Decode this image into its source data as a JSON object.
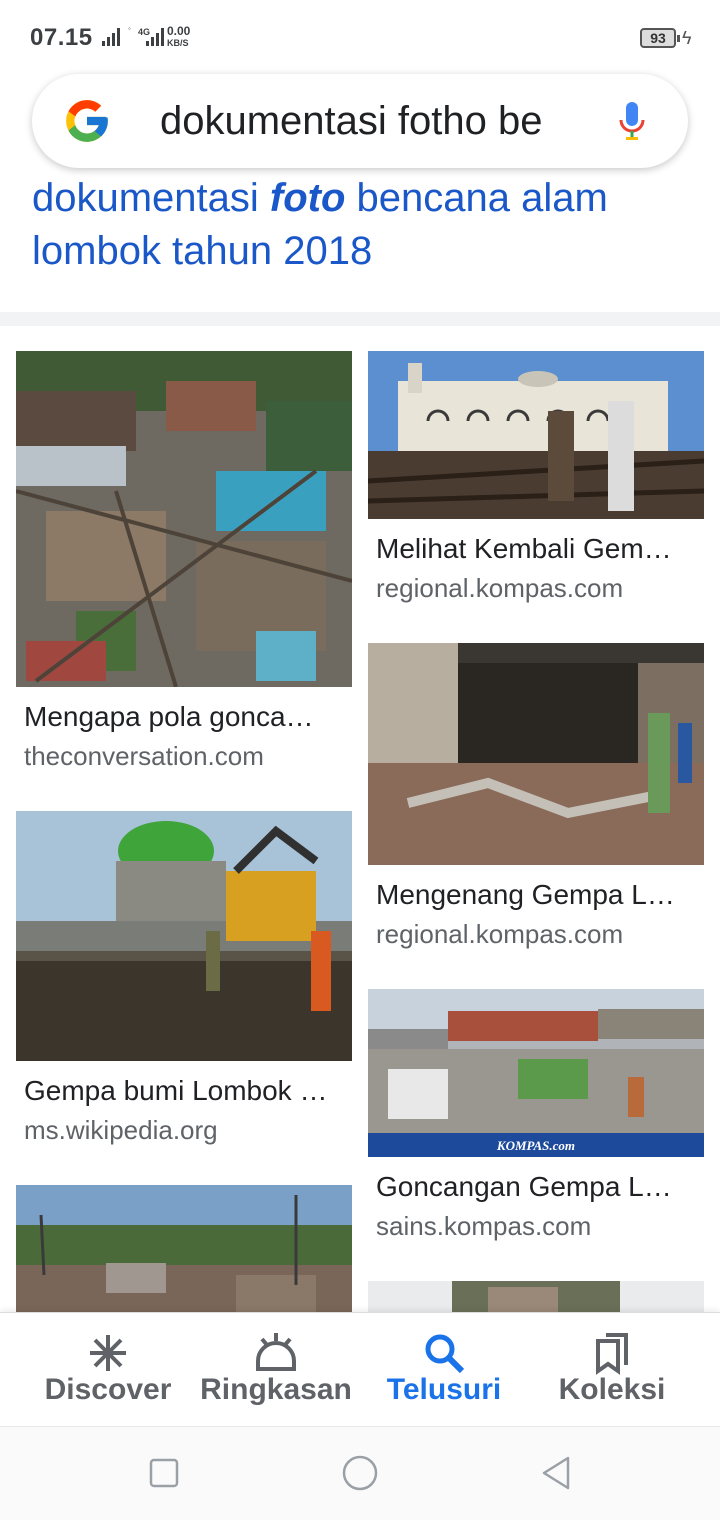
{
  "status_bar": {
    "time": "07.15",
    "network": "4G",
    "speed_value": "0.00",
    "speed_unit": "KB/S",
    "battery": "93"
  },
  "search": {
    "query": "dokumentasi fotho be",
    "google_logo_icon": "google-g-logo",
    "mic_icon": "microphone-icon"
  },
  "result": {
    "title_part1": "dokumentasi ",
    "title_bold": "foto",
    "title_part2": " bencana alam lombok tahun 2018"
  },
  "images": [
    {
      "caption": "Mengapa pola gonca…",
      "source": "theconversation.com"
    },
    {
      "caption": "Melihat Kembali Gem…",
      "source": "regional.kompas.com"
    },
    {
      "caption": "Mengenang Gempa L…",
      "source": "regional.kompas.com"
    },
    {
      "caption": "Gempa bumi Lombok …",
      "source": "ms.wikipedia.org"
    },
    {
      "caption": "Goncangan Gempa L…",
      "source": "sains.kompas.com"
    }
  ],
  "watermark": "KOMPAS.com",
  "bottom_nav": {
    "items": [
      {
        "label": "Discover",
        "icon": "asterisk-icon"
      },
      {
        "label": "Ringkasan",
        "icon": "sunrise-icon"
      },
      {
        "label": "Telusuri",
        "icon": "search-icon"
      },
      {
        "label": "Koleksi",
        "icon": "bookmarks-icon"
      }
    ],
    "active": "Telusuri",
    "active_color": "#1a73e8"
  },
  "colors": {
    "link": "#1a57c8",
    "source_text": "#5f6368"
  }
}
